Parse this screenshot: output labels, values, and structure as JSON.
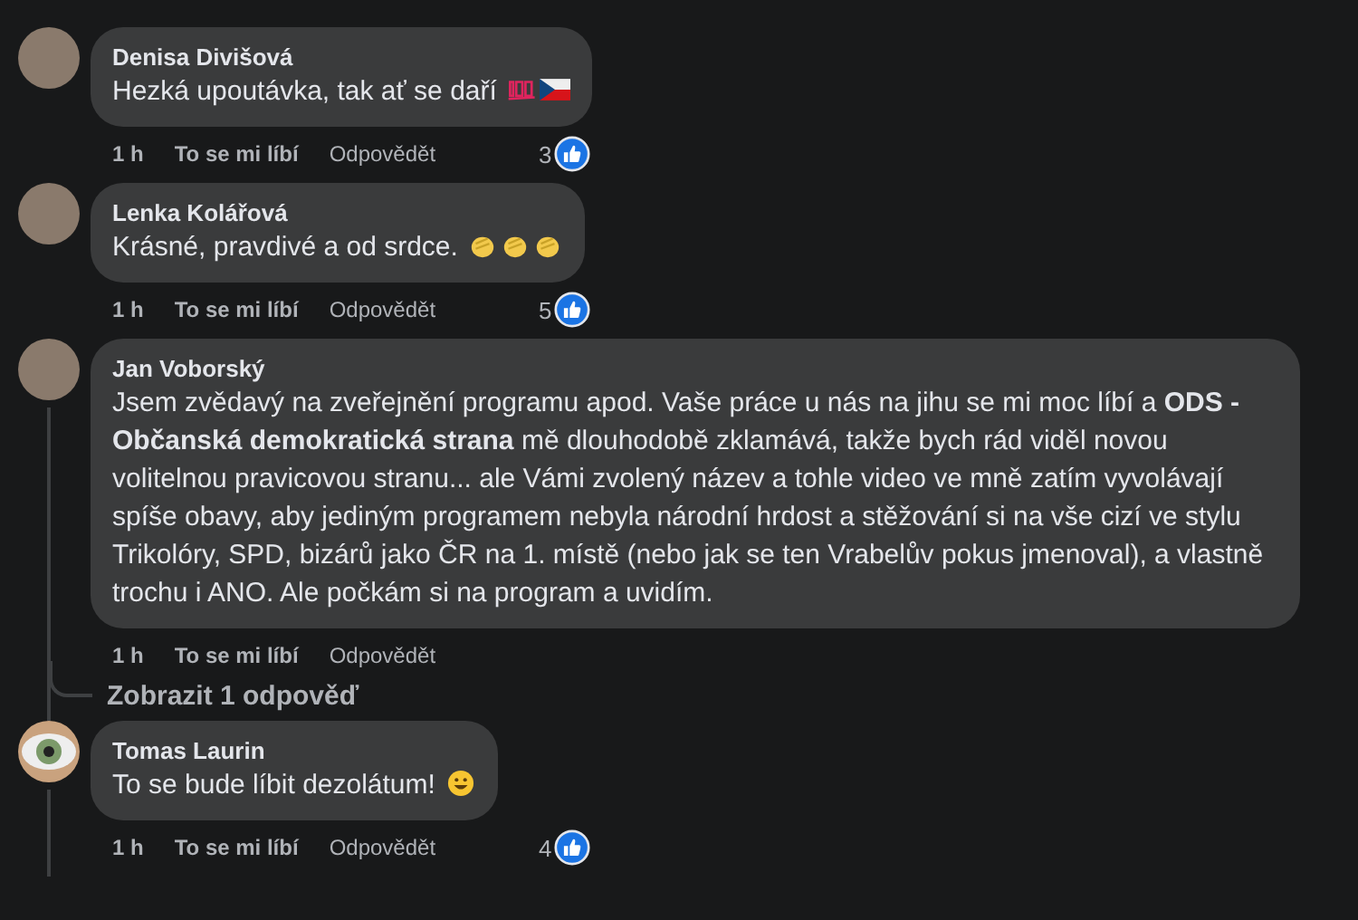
{
  "comments": [
    {
      "author": "Denisa Divišová",
      "avatar": {
        "kind": "photo"
      },
      "text": "Hezká upoutávka, tak ať se daří",
      "trailing_icons": [
        {
          "kind": "hundred"
        },
        {
          "kind": "flag"
        }
      ],
      "time": "1 h",
      "like_label": "To se mi líbí",
      "reply_label": "Odpovědět",
      "reaction_count": "3",
      "thread_line": false
    },
    {
      "author": "Lenka Kolářová",
      "avatar": {
        "kind": "photo"
      },
      "text": "Krásné, pravdivé a od srdce.",
      "trailing_icons": [
        {
          "kind": "clap"
        },
        {
          "kind": "clap"
        },
        {
          "kind": "clap"
        }
      ],
      "time": "1 h",
      "like_label": "To se mi líbí",
      "reply_label": "Odpovědět",
      "reaction_count": "5",
      "thread_line": false
    },
    {
      "author": "Jan Voborský",
      "avatar": {
        "kind": "photo"
      },
      "text": "Jsem zvědavý na zveřejnění programu apod. Vaše práce u nás na jihu se mi moc líbí a **ODS - Občanská demokratická strana** mě dlouhodobě zklamává, takže bych rád viděl novou volitelnou pravicovou stranu... ale Vámi zvolený název a tohle video ve mně zatím vyvolávají spíše obavy, aby jediným programem nebyla národní hrdost a stěžování si na vše cizí ve stylu Trikolóry, SPD, bizárů jako ČR na 1. místě (nebo jak se ten Vrabelův pokus jmenoval), a vlastně trochu i ANO. Ale počkám si na program a uvidím.",
      "time": "1 h",
      "like_label": "To se mi líbí",
      "reply_label": "Odpovědět",
      "thread_line": true,
      "replies_link": "Zobrazit 1 odpověď"
    },
    {
      "author": "Tomas Laurin",
      "avatar": {
        "kind": "eye"
      },
      "text": "To se bude líbit dezolátum!",
      "trailing_icons": [
        {
          "kind": "smile"
        }
      ],
      "time": "1 h",
      "like_label": "To se mi líbí",
      "reply_label": "Odpovědět",
      "reaction_count": "4",
      "thread_line": true
    }
  ]
}
